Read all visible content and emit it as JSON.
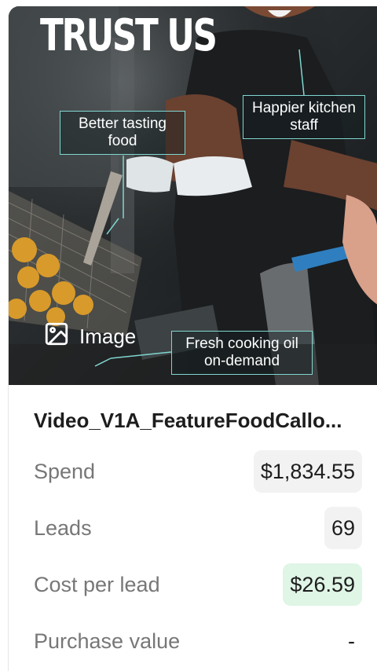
{
  "media": {
    "headline": "TRUST US",
    "callouts": [
      "Better tasting food",
      "Happier kitchen staff",
      "Fresh cooking oil on-demand"
    ],
    "type_label": "Image",
    "type_icon": "image-icon"
  },
  "ad": {
    "name": "Video_V1A_FeatureFoodCallo...",
    "metrics": [
      {
        "label": "Spend",
        "value": "$1,834.55",
        "status": "neutral"
      },
      {
        "label": "Leads",
        "value": "69",
        "status": "neutral"
      },
      {
        "label": "Cost per lead",
        "value": "$26.59",
        "status": "good"
      },
      {
        "label": "Purchase value",
        "value": "-",
        "status": "none"
      }
    ]
  },
  "colors": {
    "callout_border": "#7fd6d0",
    "good_badge": "#dff5e6",
    "neutral_badge": "#f2f2f2"
  }
}
